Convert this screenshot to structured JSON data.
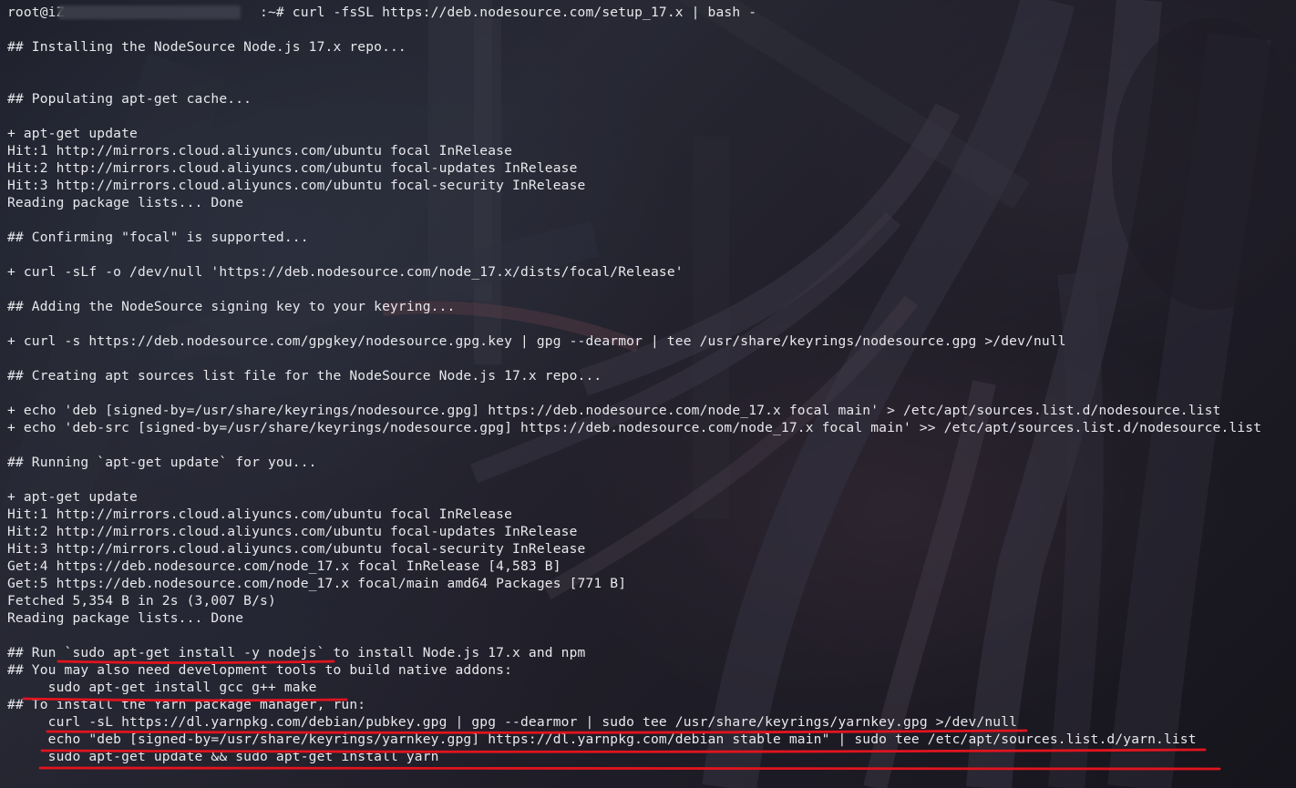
{
  "terminal": {
    "lines": [
      "root@iZ                        :~# curl -fsSL https://deb.nodesource.com/setup_17.x | bash -",
      "",
      "## Installing the NodeSource Node.js 17.x repo...",
      "",
      "",
      "## Populating apt-get cache...",
      "",
      "+ apt-get update",
      "Hit:1 http://mirrors.cloud.aliyuncs.com/ubuntu focal InRelease",
      "Hit:2 http://mirrors.cloud.aliyuncs.com/ubuntu focal-updates InRelease",
      "Hit:3 http://mirrors.cloud.aliyuncs.com/ubuntu focal-security InRelease",
      "Reading package lists... Done",
      "",
      "## Confirming \"focal\" is supported...",
      "",
      "+ curl -sLf -o /dev/null 'https://deb.nodesource.com/node_17.x/dists/focal/Release'",
      "",
      "## Adding the NodeSource signing key to your keyring...",
      "",
      "+ curl -s https://deb.nodesource.com/gpgkey/nodesource.gpg.key | gpg --dearmor | tee /usr/share/keyrings/nodesource.gpg >/dev/null",
      "",
      "## Creating apt sources list file for the NodeSource Node.js 17.x repo...",
      "",
      "+ echo 'deb [signed-by=/usr/share/keyrings/nodesource.gpg] https://deb.nodesource.com/node_17.x focal main' > /etc/apt/sources.list.d/nodesource.list",
      "+ echo 'deb-src [signed-by=/usr/share/keyrings/nodesource.gpg] https://deb.nodesource.com/node_17.x focal main' >> /etc/apt/sources.list.d/nodesource.list",
      "",
      "## Running `apt-get update` for you...",
      "",
      "+ apt-get update",
      "Hit:1 http://mirrors.cloud.aliyuncs.com/ubuntu focal InRelease",
      "Hit:2 http://mirrors.cloud.aliyuncs.com/ubuntu focal-updates InRelease",
      "Hit:3 http://mirrors.cloud.aliyuncs.com/ubuntu focal-security InRelease",
      "Get:4 https://deb.nodesource.com/node_17.x focal InRelease [4,583 B]",
      "Get:5 https://deb.nodesource.com/node_17.x focal/main amd64 Packages [771 B]",
      "Fetched 5,354 B in 2s (3,007 B/s)",
      "Reading package lists... Done",
      "",
      "## Run `sudo apt-get install -y nodejs` to install Node.js 17.x and npm",
      "## You may also need development tools to build native addons:",
      "     sudo apt-get install gcc g++ make",
      "## To install the Yarn package manager, run:",
      "     curl -sL https://dl.yarnpkg.com/debian/pubkey.gpg | gpg --dearmor | sudo tee /usr/share/keyrings/yarnkey.gpg >/dev/null",
      "     echo \"deb [signed-by=/usr/share/keyrings/yarnkey.gpg] https://dl.yarnpkg.com/debian stable main\" | sudo tee /etc/apt/sources.list.d/yarn.list",
      "     sudo apt-get update && sudo apt-get install yarn"
    ]
  },
  "colors": {
    "text": "#e8e8ec",
    "annotation": "#e0141e"
  }
}
